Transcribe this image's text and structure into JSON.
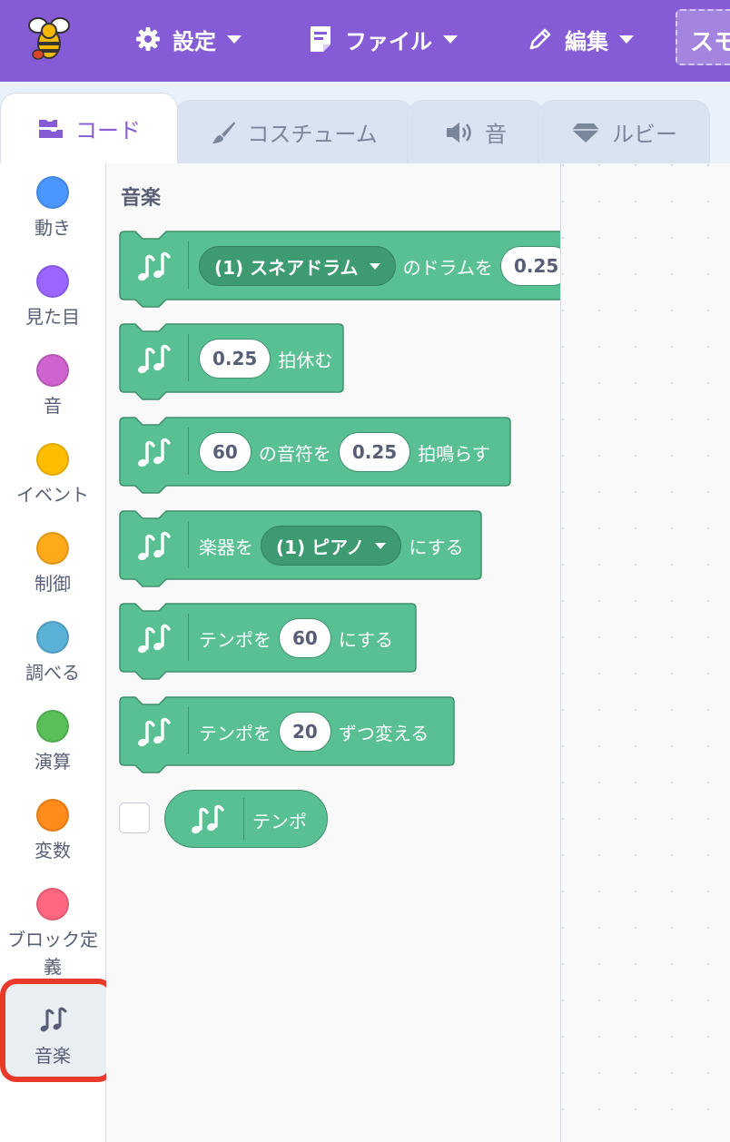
{
  "menubar": {
    "settings_label": "設定",
    "file_label": "ファイル",
    "edit_label": "編集",
    "project_tab_label": "スモ"
  },
  "tabs": {
    "code": "コード",
    "costume": "コスチューム",
    "sound": "音",
    "ruby": "ルビー"
  },
  "categories": [
    {
      "label": "動き",
      "color": "#4c97ff"
    },
    {
      "label": "見た目",
      "color": "#9966ff"
    },
    {
      "label": "音",
      "color": "#cf63cf"
    },
    {
      "label": "イベント",
      "color": "#ffbf00"
    },
    {
      "label": "制御",
      "color": "#ffab19"
    },
    {
      "label": "調べる",
      "color": "#5cb1d6"
    },
    {
      "label": "演算",
      "color": "#59c059"
    },
    {
      "label": "変数",
      "color": "#ff8c1a"
    },
    {
      "label": "ブロック定義",
      "color": "#ff6680"
    },
    {
      "label": "音楽",
      "icon": "music-notes-icon"
    }
  ],
  "flyout": {
    "section_title": "音楽",
    "block_color": "#59c093",
    "blocks": [
      {
        "drum_dropdown": "(1) スネアドラム",
        "text1": "のドラムを",
        "beats": "0.25"
      },
      {
        "beats": "0.25",
        "text1": "拍休む"
      },
      {
        "note": "60",
        "text1": "の音符を",
        "beats": "0.25",
        "text2": "拍鳴らす"
      },
      {
        "text0": "楽器を",
        "instrument_dropdown": "(1) ピアノ",
        "text1": "にする"
      },
      {
        "text0": "テンポを",
        "value": "60",
        "text1": "にする"
      },
      {
        "text0": "テンポを",
        "value": "20",
        "text1": "ずつ変える"
      }
    ],
    "reporter_label": "テンポ"
  }
}
